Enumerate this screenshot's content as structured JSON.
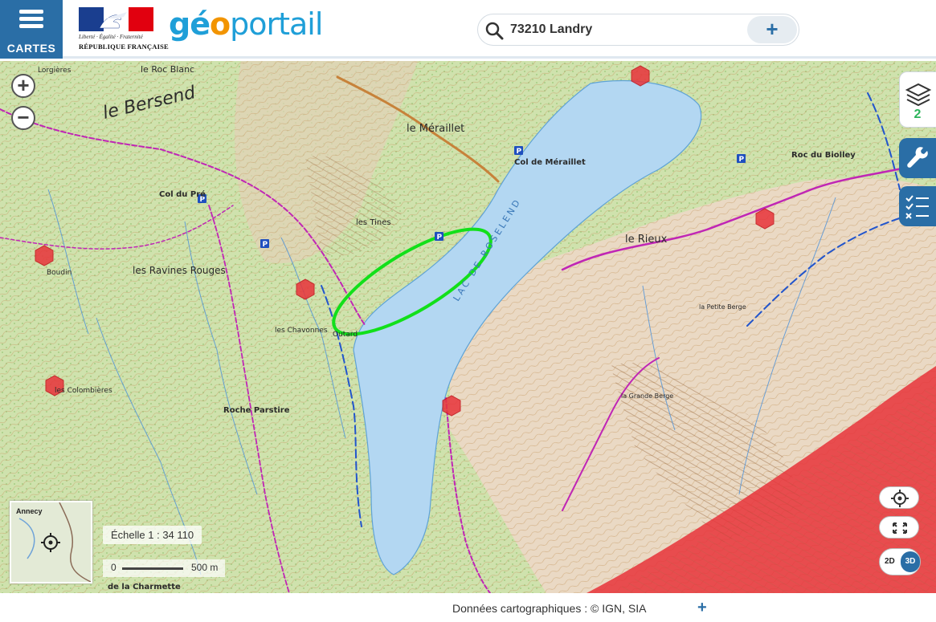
{
  "header": {
    "menu_label": "CARTES",
    "republic_motto": "Liberté · Égalité · Fraternité",
    "republic_name": "RÉPUBLIQUE FRANÇAISE",
    "brand_part1": "gé",
    "brand_part2": "o",
    "brand_part3": "portail"
  },
  "search": {
    "value": "73210 Landry",
    "add_label": "+"
  },
  "map": {
    "zoom_in": "+",
    "zoom_out": "−",
    "layers_count": "2",
    "scale_label": "Échelle 1 : 34 110",
    "scale_zero": "0",
    "scale_distance": "500 m",
    "minimap_label": "Annecy",
    "view_2d": "2D",
    "view_3d": "3D",
    "labels": {
      "bersend": "le  Bersend",
      "roc_blanc": "le Roc Blanc",
      "merailler": "le Méraillet",
      "col_merailler": "Col de Méraillet",
      "col_du_pre": "Col du Pré",
      "lac": "LAC   DE   ROSELEND",
      "rieux": "le   Rieux",
      "ravines": "les Ravines Rouges",
      "roche_parstire": "Roche Parstire",
      "roc_biolley": "Roc du Biolley",
      "tines": "les Tines",
      "grande_berge": "la Grande Berge",
      "outard": "Outard",
      "charmette": "de la Charmette",
      "lorgieres": "Lorgières",
      "chavonnes": "les Chavonnes",
      "colombieres": "les Colombières",
      "petite_berge": "la Petite Berge",
      "boudin": "Boudin"
    }
  },
  "footer": {
    "credits": "Données cartographiques : ©  IGN,  SIA",
    "more": "+"
  },
  "colors": {
    "brand_blue": "#2a6ea6",
    "geo_cyan": "#1f9fd8",
    "geo_orange": "#f29400",
    "lake": "#b3d7f2",
    "danger_zone": "#e8333a",
    "annotation": "#12e01a",
    "trail": "#c026b5"
  }
}
